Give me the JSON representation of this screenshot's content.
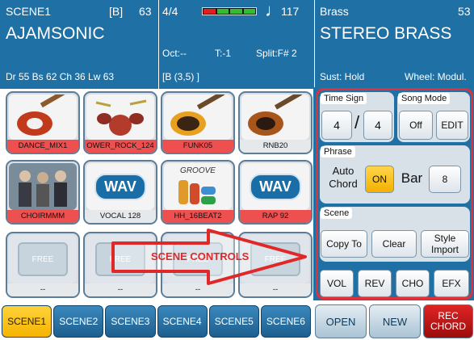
{
  "header": {
    "left": {
      "scene": "SCENE1",
      "bank": "[B]",
      "number": "63",
      "style_name": "AJAMSONIC",
      "info": "Dr 55  Bs 62  Ch 36  Lw 63"
    },
    "mid": {
      "time_sig": "4/4",
      "tempo": "117",
      "octave": "Oct:--",
      "transpose": "T:-1",
      "split": "Split:F# 2",
      "bracket": "[B       (3,5) ]"
    },
    "right": {
      "category": "Brass",
      "number": "53",
      "voice_name": "STEREO BRASS",
      "sustain": "Sust: Hold",
      "wheel": "Wheel: Modul."
    }
  },
  "pads": [
    {
      "label": "DANCE_MIX1",
      "art": "guitar-icon",
      "red": true
    },
    {
      "label": "OWER_ROCK_124",
      "art": "drumkit-icon",
      "red": true
    },
    {
      "label": "FUNK05",
      "art": "bass-guitar-icon",
      "red": true
    },
    {
      "label": "RNB20",
      "art": "bass-guitar-icon",
      "red": false
    },
    {
      "label": "CHOIRMMM",
      "art": "singers-photo-icon",
      "red": true
    },
    {
      "label": "VOCAL 128",
      "art": "wav-icon",
      "red": false
    },
    {
      "label": "HH_16BEAT2",
      "art": "groove-icon",
      "red": true
    },
    {
      "label": "RAP 92",
      "art": "wav-icon",
      "red": true
    },
    {
      "label": "--",
      "art": "free-icon",
      "red": false
    },
    {
      "label": "--",
      "art": "free-icon",
      "red": false
    },
    {
      "label": "--",
      "art": "free-icon",
      "red": false
    },
    {
      "label": "--",
      "art": "free-icon",
      "red": false
    }
  ],
  "pad_text": {
    "wav": "WAV",
    "groove": "GROOVE",
    "free": "FREE"
  },
  "overlay_label": "SCENE CONTROLS",
  "scenes": [
    "SCENE1",
    "SCENE2",
    "SCENE3",
    "SCENE4",
    "SCENE5",
    "SCENE6"
  ],
  "controls": {
    "time_sign": {
      "tag": "Time Sign",
      "numerator": "4",
      "slash": "/",
      "denominator": "4"
    },
    "song_mode": {
      "tag": "Song Mode",
      "off": "Off",
      "edit": "EDIT"
    },
    "phrase": {
      "tag": "Phrase",
      "auto_chord": "Auto Chord",
      "on": "ON",
      "bar": "Bar",
      "bar_value": "8"
    },
    "scene": {
      "tag": "Scene",
      "copy_to": "Copy To",
      "clear": "Clear",
      "style_import": "Style Import"
    },
    "mix": {
      "vol": "VOL",
      "rev": "REV",
      "cho": "CHO",
      "efx": "EFX"
    }
  },
  "bottom_buttons": {
    "open": "OPEN",
    "new": "NEW",
    "rec_chord": "REC CHORD"
  },
  "colors": {
    "header_blue": "#1f70a4",
    "highlight_red": "#e0303a",
    "active_yellow": "#f5b400"
  }
}
